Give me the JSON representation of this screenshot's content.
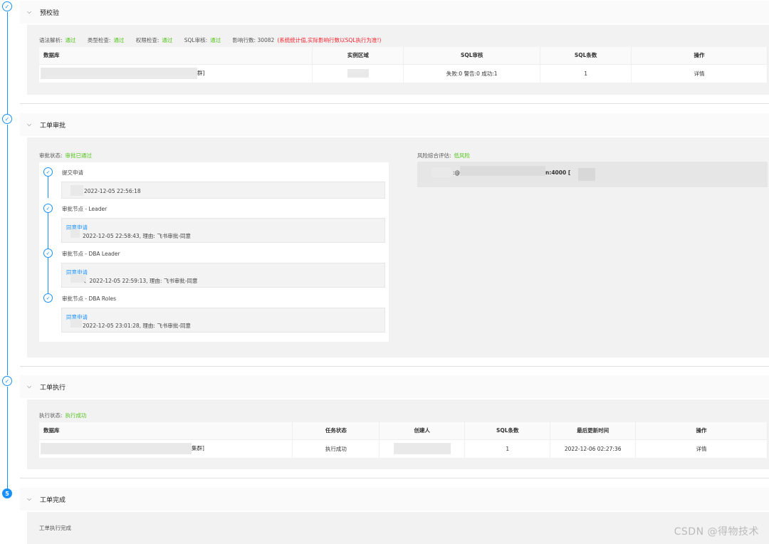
{
  "timeline": {
    "step5_number": "5",
    "check": "✓"
  },
  "precheck": {
    "title": "预校验",
    "status": [
      {
        "label": "语法解析:",
        "value": "通过"
      },
      {
        "label": "类型检查:",
        "value": "通过"
      },
      {
        "label": "权限检查:",
        "value": "通过"
      },
      {
        "label": "SQL审核:",
        "value": "通过"
      }
    ],
    "affected_rows_label": "影响行数: 30082",
    "affected_rows_note": "(系统统计值,实际影响行数以SQL执行为准!)",
    "columns": [
      "数据库",
      "实例区域",
      "SQL审核",
      "SQL条数",
      "操作"
    ],
    "row": {
      "database_suffix": "群]",
      "audit": "失败:0 警告:0 成功:1",
      "count": "1",
      "action": "详情"
    }
  },
  "approval": {
    "title": "工单审批",
    "status_label": "审批状态:",
    "status_value": "审批已通过",
    "risk_label": "风险综合评估:",
    "risk_value": "低风险",
    "risk_fragment_a": ":@",
    "risk_fragment_b": "n:4000 [",
    "steps": [
      {
        "name": "提交申请",
        "agree": "",
        "detail": "2022-12-05 22:56:18"
      },
      {
        "name": "审批节点 - Leader",
        "agree": "同意申请",
        "detail": "2022-12-05 22:58:43, 理由: 飞书审批-同意"
      },
      {
        "name": "审批节点 - DBA Leader",
        "agree": "同意申请",
        "detail": "、2022-12-05 22:59:13, 理由: 飞书审批-同意"
      },
      {
        "name": "审批节点 - DBA Roles",
        "agree": "同意申请",
        "detail": "2022-12-05 23:01:28, 理由: 飞书审批-同意"
      }
    ]
  },
  "execution": {
    "title": "工单执行",
    "status_label": "执行状态:",
    "status_value": "执行成功",
    "columns": [
      "数据库",
      "任务状态",
      "创建人",
      "SQL条数",
      "最后更新时间",
      "操作"
    ],
    "row": {
      "database_suffix": "集群]",
      "task_status": "执行成功",
      "count": "1",
      "updated": "2022-12-06 02:27:36",
      "action": "详情"
    }
  },
  "completion": {
    "title": "工单完成",
    "text": "工单执行完成"
  },
  "watermark": "CSDN @得物技术"
}
